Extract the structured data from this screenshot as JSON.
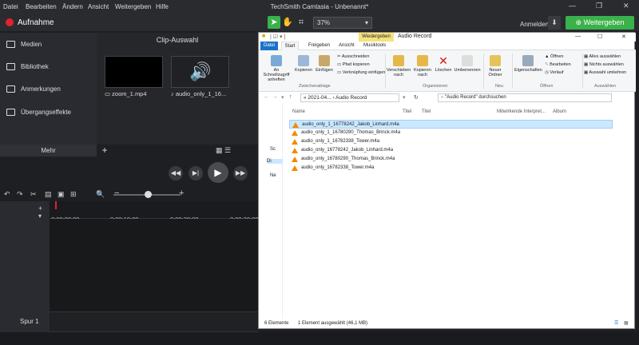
{
  "app": {
    "title": "TechSmith Camtasia - Unbenannt*",
    "menu": [
      "Datei",
      "Bearbeiten",
      "Ändern",
      "Ansicht",
      "Weitergeben",
      "Hilfe"
    ],
    "record_label": "Aufnahme",
    "zoom": "37%",
    "login": "Anmelden",
    "share": "Weitergeben"
  },
  "sidebar": {
    "items": [
      {
        "label": "Medien",
        "icon": "media-icon"
      },
      {
        "label": "Bibliothek",
        "icon": "library-icon"
      },
      {
        "label": "Anmerkungen",
        "icon": "annotations-icon"
      },
      {
        "label": "Übergangseffekte",
        "icon": "transitions-icon"
      }
    ],
    "more": "Mehr"
  },
  "clips": {
    "header": "Clip-Auswahl",
    "items": [
      {
        "label": "zoom_1.mp4"
      },
      {
        "label": "audio_only_1_16..."
      }
    ]
  },
  "timeline": {
    "ticks": [
      "0:00:00;00",
      "0:00:10;00",
      "0:00:20;00",
      "0:00:30;00"
    ],
    "track_label": "Spur 1"
  },
  "explorer": {
    "context_tab": "Wiedergeben",
    "title": "Audio Record",
    "tabs": [
      "Datei",
      "Start",
      "Freigeben",
      "Ansicht",
      "Musiktools"
    ],
    "ribbon": {
      "clipboard": {
        "pin": "An Schnellzugriff anheften",
        "copy": "Kopieren",
        "paste": "Einfügen",
        "cut": "Ausschneiden",
        "copy_path": "Pfad kopieren",
        "paste_link": "Verknüpfung einfügen",
        "group": "Zwischenablage"
      },
      "organize": {
        "move": "Verschieben nach",
        "copyto": "Kopieren nach",
        "delete": "Löschen",
        "rename": "Umbenennen",
        "group": "Organisieren"
      },
      "new": {
        "folder": "Neuer Ordner",
        "group": "Neu"
      },
      "open": {
        "properties": "Eigenschaften",
        "open": "Öffnen",
        "edit": "Bearbeiten",
        "history": "Verlauf",
        "group": "Öffnen"
      },
      "select": {
        "all": "Alles auswählen",
        "none": "Nichts auswählen",
        "invert": "Auswahl umkehren",
        "group": "Auswählen"
      }
    },
    "address": "« 2021-04... › Audio Record",
    "search_placeholder": "\"Audio Record\" durchsuchen",
    "nav": [
      "Sc",
      "Di",
      "Ne"
    ],
    "columns": [
      "Name",
      "Titel",
      "Titel",
      "Mitwirkende Interpret...",
      "Album"
    ],
    "files": [
      {
        "name": "audio_only_1_16778242_Jakob_Linhard.m4a",
        "selected": true
      },
      {
        "name": "audio_only_1_16780290_Thomas_Brinck.m4a",
        "selected": false
      },
      {
        "name": "audio_only_1_16782338_Tower.m4a",
        "selected": false
      },
      {
        "name": "audio_only_16778242_Jakob_Linhard.m4a",
        "selected": false
      },
      {
        "name": "audio_only_16780290_Thomas_Brinck.m4a",
        "selected": false
      },
      {
        "name": "audio_only_16782338_Tower.m4a",
        "selected": false
      }
    ],
    "status_count": "6 Elemente",
    "status_sel": "1 Element ausgewählt (46,1 MB)"
  },
  "colors": {
    "accent": "#3ab14a",
    "record": "#e0232e",
    "selection": "#cce8ff",
    "file_tab": "#1a73c9"
  }
}
